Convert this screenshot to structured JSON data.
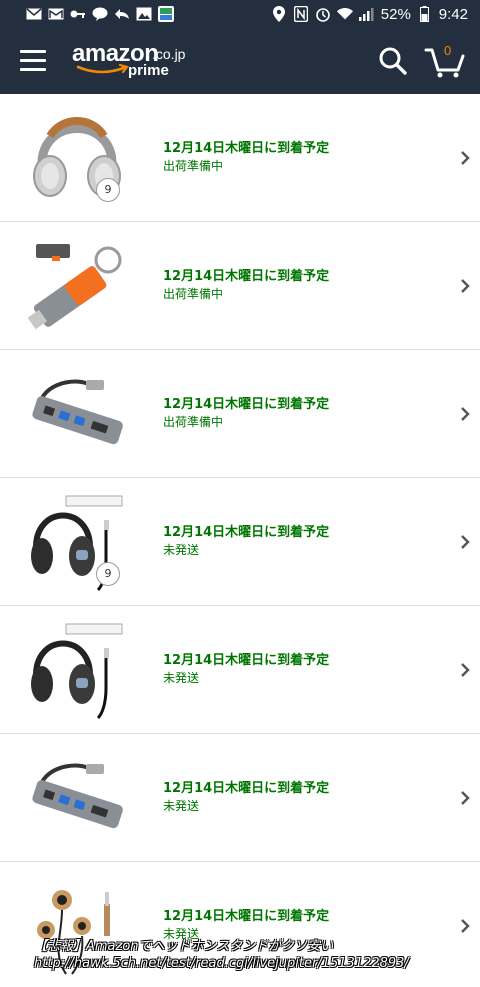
{
  "status_bar": {
    "battery": "52%",
    "time": "9:42"
  },
  "header": {
    "logo_main": "amazon",
    "logo_tld": ".co.jp",
    "logo_sub": "prime",
    "cart_count": "0"
  },
  "orders": [
    {
      "delivery": "12月14日木曜日に到着予定",
      "status": "出荷準備中",
      "qty": "9",
      "product_icon": "headphones-brown-icon"
    },
    {
      "delivery": "12月14日木曜日に到着予定",
      "status": "出荷準備中",
      "product_icon": "usb-c-card-reader-icon"
    },
    {
      "delivery": "12月14日木曜日に到着予定",
      "status": "出荷準備中",
      "product_icon": "usb-c-hub-icon"
    },
    {
      "delivery": "12月14日木曜日に到着予定",
      "status": "未発送",
      "qty": "9",
      "product_icon": "headphones-black-icon"
    },
    {
      "delivery": "12月14日木曜日に到着予定",
      "status": "未発送",
      "product_icon": "headphones-black-icon"
    },
    {
      "delivery": "12月14日木曜日に到着予定",
      "status": "未発送",
      "product_icon": "usb-c-hub-icon"
    },
    {
      "delivery": "12月14日木曜日に到着予定",
      "status": "未発送",
      "product_icon": "earphones-wood-icon"
    }
  ],
  "watermark": {
    "line1": "【悲報】Amazonでヘッドホンスタンドがクソ安い",
    "line2": "http://hawk.5ch.net/test/read.cgi/livejupiter/1513122893/"
  },
  "colors": {
    "header_bg": "#232f3e",
    "status_green": "#007600",
    "cart_orange": "#f08804"
  }
}
